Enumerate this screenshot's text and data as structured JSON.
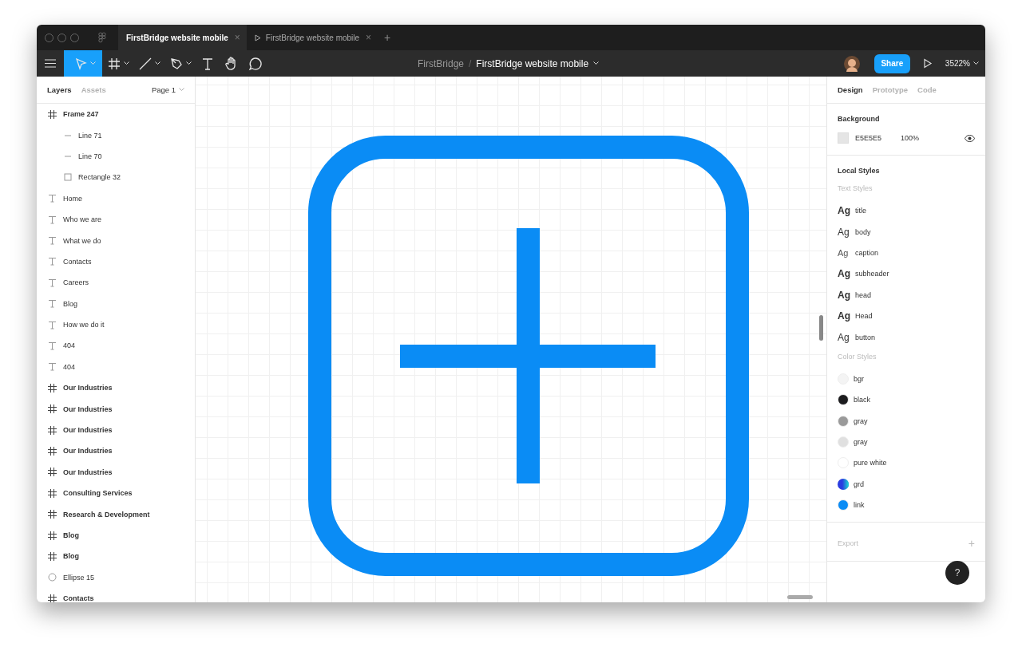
{
  "window": {
    "tabs": [
      {
        "label": "FirstBridge website mobile",
        "kind": "file",
        "selected": true,
        "close": "×"
      },
      {
        "label": "FirstBridge website mobile",
        "kind": "prototype",
        "selected": false,
        "close": "×"
      }
    ],
    "new_tab": "+"
  },
  "toolbar": {
    "tools": [
      {
        "kind": "move",
        "selected": true,
        "dropdown": true
      },
      {
        "kind": "frame",
        "selected": false,
        "dropdown": true
      },
      {
        "kind": "line",
        "selected": false,
        "dropdown": true
      },
      {
        "kind": "pen",
        "selected": false,
        "dropdown": true
      },
      {
        "kind": "text",
        "selected": false,
        "dropdown": false
      },
      {
        "kind": "hand",
        "selected": false,
        "dropdown": false
      },
      {
        "kind": "comment",
        "selected": false,
        "dropdown": false
      }
    ],
    "breadcrumb": {
      "team": "FirstBridge",
      "separator": "/",
      "file": "FirstBridge website mobile"
    },
    "share": "Share",
    "zoom": "3522%"
  },
  "layers_panel": {
    "tabs": [
      {
        "label": "Layers",
        "selected": true
      },
      {
        "label": "Assets",
        "selected": false
      }
    ],
    "page": "Page 1",
    "layers": [
      {
        "name": "Frame 247",
        "kind": "frame",
        "children": [
          {
            "name": "Line 71",
            "kind": "line"
          },
          {
            "name": "Line 70",
            "kind": "line"
          },
          {
            "name": "Rectangle 32",
            "kind": "rect"
          }
        ]
      },
      {
        "name": "Home",
        "kind": "text"
      },
      {
        "name": "Who we are",
        "kind": "text"
      },
      {
        "name": "What we do",
        "kind": "text"
      },
      {
        "name": "Contacts",
        "kind": "text"
      },
      {
        "name": "Careers",
        "kind": "text"
      },
      {
        "name": "Blog",
        "kind": "text"
      },
      {
        "name": "How we do it",
        "kind": "text"
      },
      {
        "name": "404",
        "kind": "text"
      },
      {
        "name": "404",
        "kind": "text"
      },
      {
        "name": "Our Industries",
        "kind": "frame"
      },
      {
        "name": "Our Industries",
        "kind": "frame"
      },
      {
        "name": "Our Industries",
        "kind": "frame"
      },
      {
        "name": "Our Industries",
        "kind": "frame"
      },
      {
        "name": "Our Industries",
        "kind": "frame"
      },
      {
        "name": "Consulting Services",
        "kind": "frame"
      },
      {
        "name": "Research & Development",
        "kind": "frame"
      },
      {
        "name": "Blog",
        "kind": "frame"
      },
      {
        "name": "Blog",
        "kind": "frame"
      },
      {
        "name": "Ellipse 15",
        "kind": "ellipse"
      },
      {
        "name": "Contacts",
        "kind": "frame"
      }
    ]
  },
  "design_panel": {
    "tabs": [
      {
        "label": "Design",
        "selected": true
      },
      {
        "label": "Prototype",
        "selected": false
      },
      {
        "label": "Code",
        "selected": false
      }
    ],
    "background": {
      "title": "Background",
      "color": "#e5e5e5",
      "hex": "E5E5E5",
      "opacity": "100%"
    },
    "local_styles": {
      "title": "Local Styles",
      "text_styles_title": "Text Styles",
      "text_styles": [
        {
          "sample": "Ag",
          "name": "title",
          "kind": "bold"
        },
        {
          "sample": "Ag",
          "name": "body",
          "kind": "regular"
        },
        {
          "sample": "Ag",
          "name": "caption",
          "kind": "light"
        },
        {
          "sample": "Ag",
          "name": "subheader",
          "kind": "bold"
        },
        {
          "sample": "Ag",
          "name": "head",
          "kind": "bold"
        },
        {
          "sample": "Ag",
          "name": "Head",
          "kind": "bold"
        },
        {
          "sample": "Ag",
          "name": "button",
          "kind": "medium"
        }
      ],
      "color_styles_title": "Color Styles",
      "color_styles": [
        {
          "name": "bgr",
          "kind": "solid",
          "color": "#f4f4f4"
        },
        {
          "name": "black",
          "kind": "solid",
          "color": "#1c1c1e"
        },
        {
          "name": "gray",
          "kind": "solid",
          "color": "#9a9a9a"
        },
        {
          "name": "gray",
          "kind": "solid",
          "color": "#e0e0e0"
        },
        {
          "name": "pure white",
          "kind": "solid",
          "color": "#ffffff"
        },
        {
          "name": "grd",
          "kind": "gradient",
          "color": "#2a3de0"
        },
        {
          "name": "link",
          "kind": "solid",
          "color": "#0a8cf5"
        }
      ]
    },
    "export": "Export",
    "export_add": "+"
  },
  "help": "?"
}
